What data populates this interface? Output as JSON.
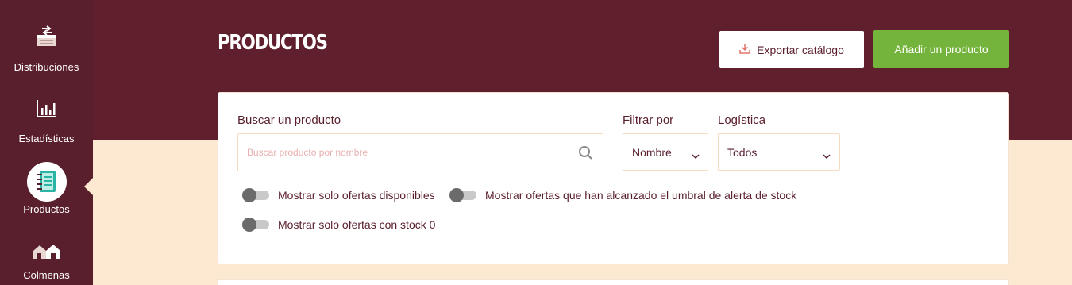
{
  "sidebar": {
    "items": [
      {
        "label": "Distribuciones",
        "icon": "distribution-icon"
      },
      {
        "label": "Estadísticas",
        "icon": "statistics-icon"
      },
      {
        "label": "Productos",
        "icon": "products-icon",
        "active": true
      },
      {
        "label": "Colmenas",
        "icon": "hives-icon"
      }
    ]
  },
  "header": {
    "title": "PRODUCTOS",
    "export_label": "Exportar catálogo",
    "add_label": "Añadir un producto"
  },
  "filters": {
    "search_label": "Buscar un producto",
    "search_placeholder": "Buscar producto por nombre",
    "filter_by_label": "Filtrar por",
    "filter_by_value": "Nombre",
    "logistics_label": "Logística",
    "logistics_value": "Todos"
  },
  "toggles": [
    {
      "label": "Mostrar solo ofertas disponibles",
      "on": false
    },
    {
      "label": "Mostrar ofertas que han alcanzado el umbral de alerta de stock",
      "on": false
    },
    {
      "label": "Mostrar solo ofertas con stock 0",
      "on": false
    }
  ],
  "colors": {
    "primary": "#5f1f2d",
    "accent_green": "#75b43c",
    "background": "#fde8d2"
  }
}
